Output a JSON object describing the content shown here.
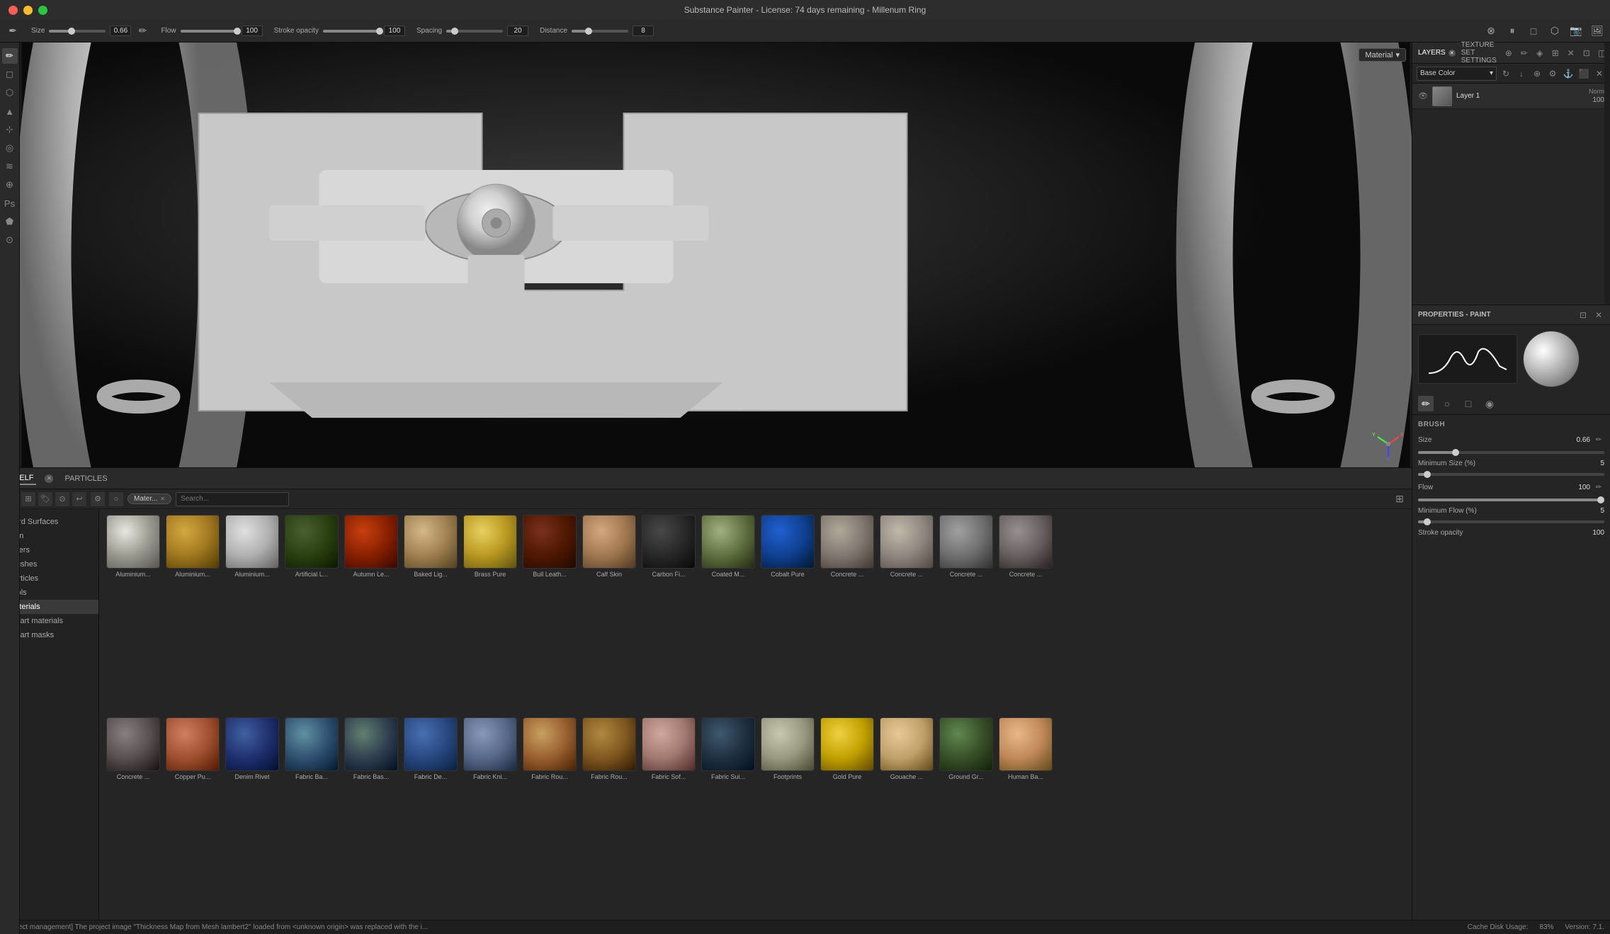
{
  "app": {
    "title": "Substance Painter - License: 74 days remaining - Millenum Ring"
  },
  "titlebar": {
    "buttons": [
      "close",
      "minimize",
      "maximize"
    ]
  },
  "top_toolbar": {
    "size_label": "Size",
    "size_value": "0.66",
    "flow_label": "Flow",
    "flow_value": "100",
    "stroke_opacity_label": "Stroke opacity",
    "stroke_opacity_value": "100",
    "spacing_label": "Spacing",
    "spacing_value": "20",
    "distance_label": "Distance",
    "distance_value": "8"
  },
  "viewport": {
    "material_dropdown": "Material",
    "dropdown_arrow": "▾"
  },
  "right_panel": {
    "tabs": [
      {
        "label": "LAYERS",
        "active": true
      },
      {
        "label": "TEXTURE SET SETTINGS",
        "active": false
      }
    ],
    "layers_channel": "Base Color",
    "layer": {
      "name": "Layer 1",
      "mode": "Norm",
      "opacity": "100"
    },
    "icons": [
      "↻",
      "↓",
      "✏",
      "⊕",
      "⊞",
      "⊟",
      "✕",
      "⊡",
      "◫"
    ]
  },
  "properties_panel": {
    "title": "PROPERTIES - PAINT",
    "brush_section": "BRUSH",
    "size_label": "Size",
    "size_value": "0.66",
    "min_size_label": "Minimum Size (%)",
    "min_size_value": "5",
    "flow_label": "Flow",
    "flow_value": "100",
    "min_flow_label": "Minimum Flow (%)",
    "min_flow_value": "5",
    "stroke_opacity_label": "Stroke opacity",
    "stroke_opacity_value": "100"
  },
  "shelf": {
    "tabs": [
      {
        "label": "SHELF",
        "active": true
      },
      {
        "label": "PARTICLES",
        "active": false
      }
    ],
    "sidebar_items": [
      {
        "label": "Hard Surfaces",
        "active": false
      },
      {
        "label": "Skin",
        "active": false
      },
      {
        "label": "Filters",
        "active": false
      },
      {
        "label": "Brushes",
        "active": false
      },
      {
        "label": "Particles",
        "active": false
      },
      {
        "label": "Tools",
        "active": false
      },
      {
        "label": "Materials",
        "active": true
      },
      {
        "label": "Smart materials",
        "active": false
      },
      {
        "label": "Smart masks",
        "active": false
      }
    ],
    "filter_chip": "Mater...",
    "search_placeholder": "Search...",
    "materials_row1": [
      {
        "name": "Aluminium...",
        "class": "mat-alum1"
      },
      {
        "name": "Aluminium...",
        "class": "mat-alum2"
      },
      {
        "name": "Aluminium...",
        "class": "mat-alum3"
      },
      {
        "name": "Artificial L...",
        "class": "mat-artleaf"
      },
      {
        "name": "Autumn Le...",
        "class": "mat-autleaf"
      },
      {
        "name": "Baked Lig...",
        "class": "mat-baked"
      },
      {
        "name": "Brass Pure",
        "class": "mat-brasspure"
      },
      {
        "name": "Bull Leath...",
        "class": "mat-bullleather"
      },
      {
        "name": "Calf Skin",
        "class": "mat-calfskin"
      },
      {
        "name": "Carbon Fi...",
        "class": "mat-carbonfi"
      },
      {
        "name": "Coated M...",
        "class": "mat-coated"
      },
      {
        "name": "Cobalt Pure",
        "class": "mat-cobaltpure"
      },
      {
        "name": "Concrete ...",
        "class": "mat-concrete1"
      },
      {
        "name": "Concrete ...",
        "class": "mat-concrete2"
      },
      {
        "name": "Concrete ...",
        "class": "mat-concrete3"
      },
      {
        "name": "Concrete ...",
        "class": "mat-concrete4"
      }
    ],
    "materials_row2": [
      {
        "name": "Concrete ...",
        "class": "mat-concrete5"
      },
      {
        "name": "Copper Pu...",
        "class": "mat-copperpu"
      },
      {
        "name": "Denim Rivet",
        "class": "mat-denimriv"
      },
      {
        "name": "Fabric Ba...",
        "class": "mat-fabricba1"
      },
      {
        "name": "Fabric Bas...",
        "class": "mat-fabricba2"
      },
      {
        "name": "Fabric De...",
        "class": "mat-fabricde"
      },
      {
        "name": "Fabric Kni...",
        "class": "mat-fabrickni"
      },
      {
        "name": "Fabric Rou...",
        "class": "mat-fabricrou1"
      },
      {
        "name": "Fabric Rou...",
        "class": "mat-fabricrou2"
      },
      {
        "name": "Fabric Sof...",
        "class": "mat-fabricsoft"
      },
      {
        "name": "Fabric Sui...",
        "class": "mat-fabricsui"
      },
      {
        "name": "Footprints",
        "class": "mat-footprints"
      },
      {
        "name": "Gold Pure",
        "class": "mat-goldpure"
      },
      {
        "name": "Gouache ...",
        "class": "mat-gouache"
      },
      {
        "name": "Ground Gr...",
        "class": "mat-groundgr"
      },
      {
        "name": "Human Ba...",
        "class": "mat-humanba"
      }
    ]
  },
  "status_bar": {
    "message": "Project management] The project image \"Thickness Map from Mesh lambert2\" loaded from <unknown origin> was replaced with the i...",
    "cache_disk": "Cache Disk Usage:",
    "cache_value": "83%",
    "version_label": "Version: 7.1."
  }
}
